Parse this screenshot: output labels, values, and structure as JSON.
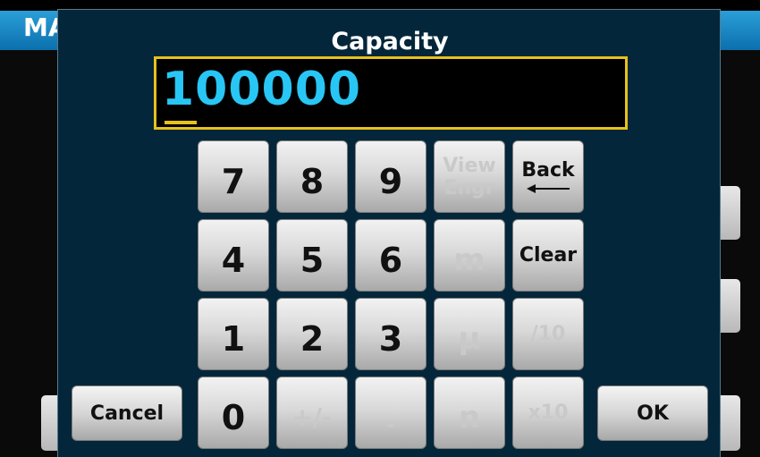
{
  "background": {
    "title": "MA"
  },
  "dialog": {
    "title": "Capacity",
    "value": "100000"
  },
  "keypad": {
    "row1": [
      "7",
      "8",
      "9"
    ],
    "view_engr": [
      "View",
      "Engr"
    ],
    "back": "Back",
    "row2": [
      "4",
      "5",
      "6"
    ],
    "milli": "m",
    "clear": "Clear",
    "row3": [
      "1",
      "2",
      "3"
    ],
    "micro": "μ",
    "div10": "/10",
    "zero": "0",
    "plus_minus": "+/-",
    "decimal": ".",
    "nano": "n",
    "x10": "x10"
  },
  "actions": {
    "cancel": "Cancel",
    "ok": "OK"
  },
  "colors": {
    "value": "#28c6f4",
    "entry_border": "#e7c11b",
    "dialog_bg": "#04263a"
  }
}
